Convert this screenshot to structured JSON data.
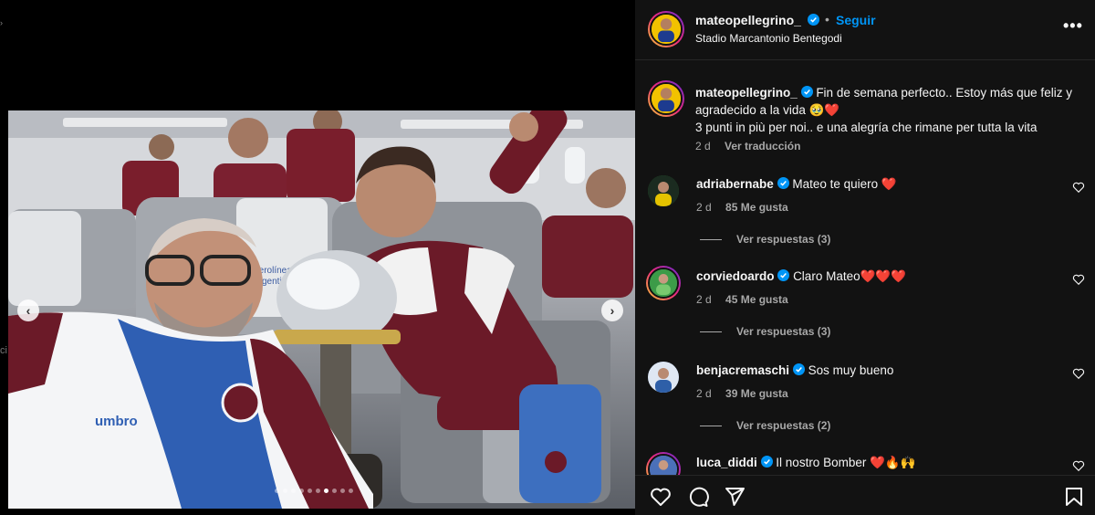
{
  "media": {
    "photo_description_alt": "",
    "carousel": {
      "total_dots": 10,
      "active_index": 6
    }
  },
  "post": {
    "username": "mateopellegrino_",
    "separator": "•",
    "follow_label": "Seguir",
    "location": "Stadio Marcantonio Bentegodi",
    "more_label": "•••"
  },
  "caption": {
    "username": "mateopellegrino_",
    "line1": "Fin de semana perfecto.. Estoy más que feliz y agradecido a la vida 🥹❤️",
    "line2": "3 punti in più per noi.. e una alegría che rimane per tutta la vita",
    "time": "2 d",
    "translate_label": "Ver traducción"
  },
  "comments": [
    {
      "username": "adriabernabe",
      "text": "Mateo te quiero ❤️",
      "time": "2 d",
      "likes": "85 Me gusta",
      "replies": "Ver respuestas (3)",
      "avatar_color": "#2e7d32"
    },
    {
      "username": "corviedoardo",
      "text": "Claro Mateo❤️❤️❤️",
      "time": "2 d",
      "likes": "45 Me gusta",
      "replies": "Ver respuestas (3)",
      "avatar_color": "#4caf50"
    },
    {
      "username": "benjacremaschi",
      "text": "Sos muy bueno",
      "time": "2 d",
      "likes": "39 Me gusta",
      "replies": "Ver respuestas (2)",
      "avatar_color": "#3f6ea8"
    },
    {
      "username": "luca_diddi",
      "text": "Il nostro Bomber ❤️🔥🙌",
      "time": "",
      "likes": "",
      "replies": "",
      "avatar_color": "#8a5a3c"
    }
  ],
  "colors": {
    "accent_blue": "#0095f6",
    "verified_blue": "#0095f6",
    "panel_bg": "#121212",
    "secondary_text": "#a8a8a8"
  },
  "icons": {
    "like": "heart-icon",
    "comment": "comment-icon",
    "share": "send-icon",
    "save": "bookmark-icon",
    "more": "more-icon",
    "prev": "chevron-left-icon",
    "next": "chevron-right-icon"
  }
}
